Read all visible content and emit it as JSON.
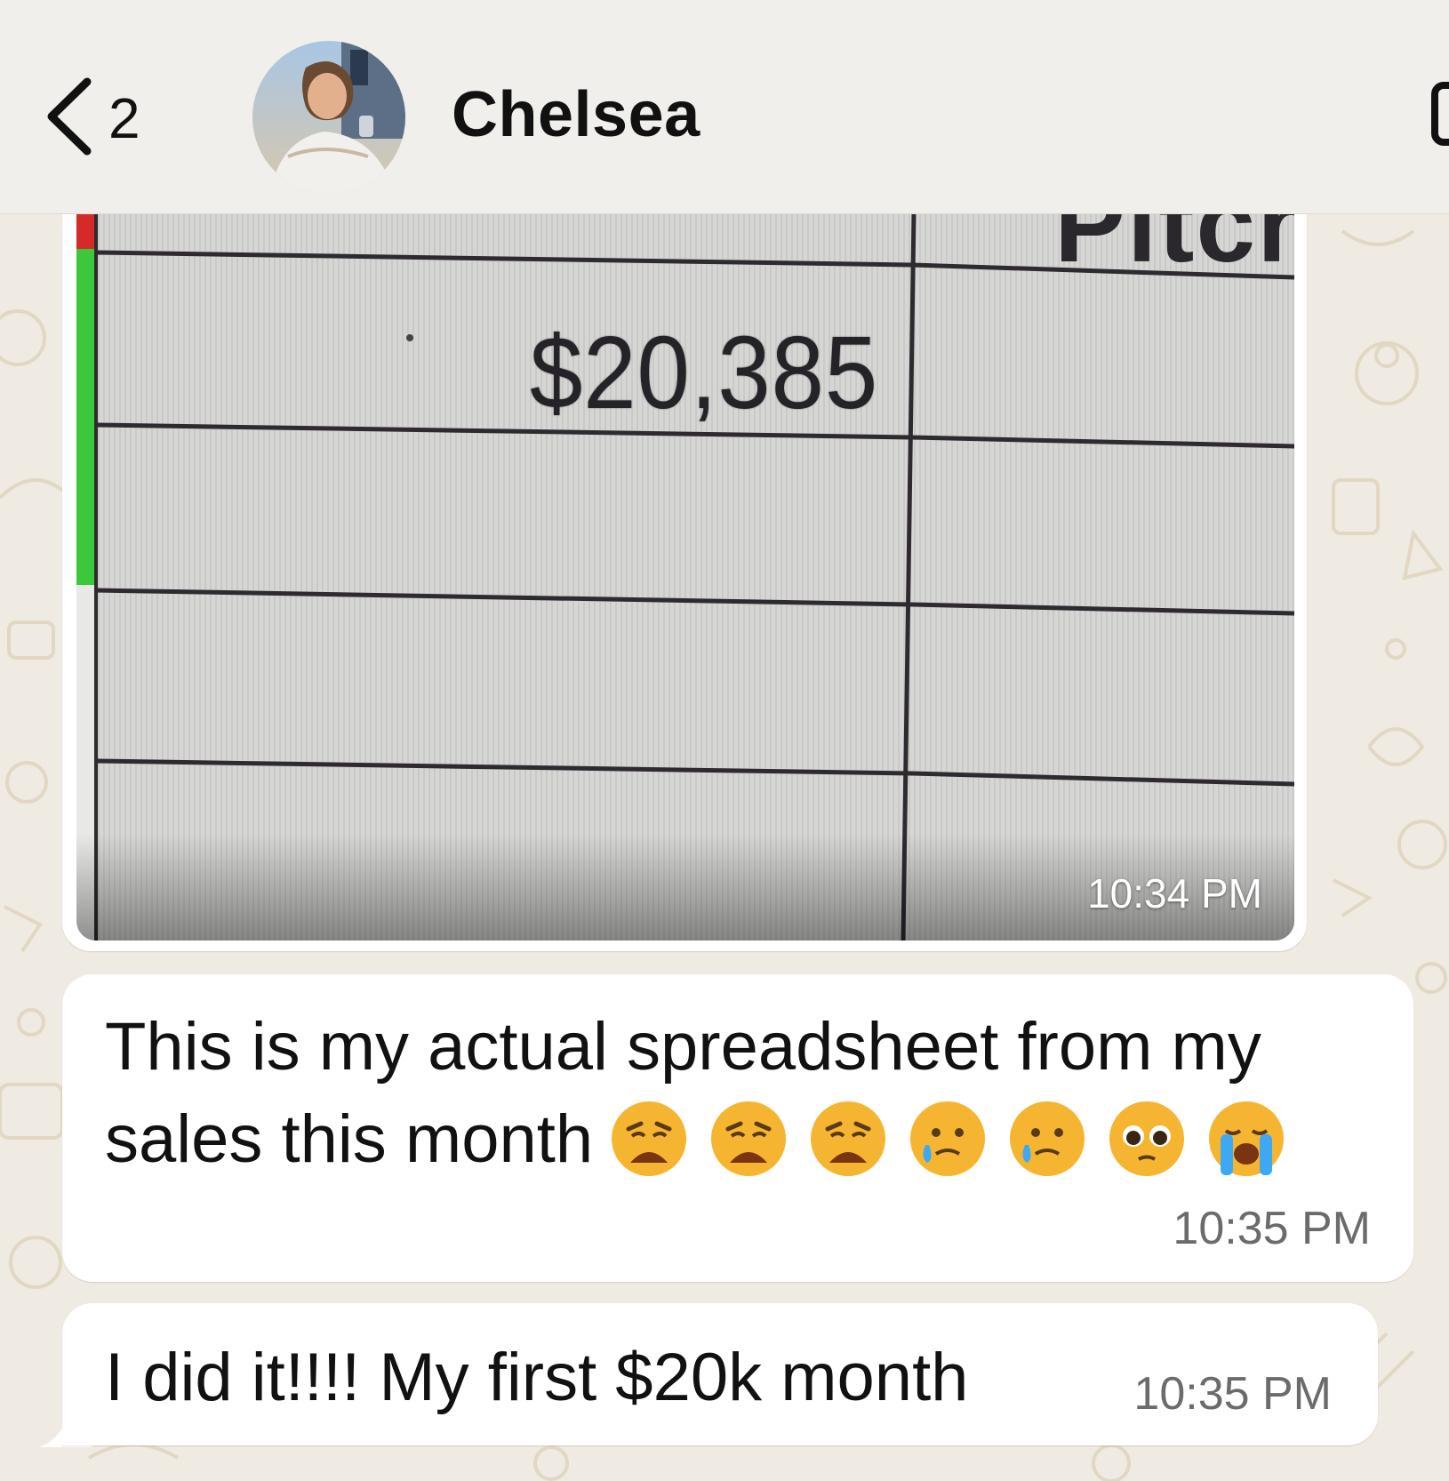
{
  "header": {
    "back_count": "2",
    "contact_name": "Chelsea",
    "icons": [
      "chevron-left-icon",
      "avatar",
      "video-call-icon"
    ]
  },
  "messages": [
    {
      "type": "image",
      "image_text": {
        "amount": "$20,385",
        "column_header_partial": "Pitch"
      },
      "time": "10:34 PM"
    },
    {
      "type": "text",
      "text": "This is my actual spreadsheet from my sales this month",
      "emojis": [
        "weary-face",
        "weary-face",
        "weary-face",
        "face-holding-back-tears",
        "face-holding-back-tears",
        "pleading-face",
        "loudly-crying-face"
      ],
      "time": "10:35 PM"
    },
    {
      "type": "text",
      "text": "I did it!!!! My first $20k month",
      "time": "10:35 PM"
    }
  ],
  "colors": {
    "wallpaper": "#efeae2",
    "header_bg": "#f0efeb",
    "bubble_bg": "#ffffff",
    "time_text": "#6b6b6b"
  }
}
